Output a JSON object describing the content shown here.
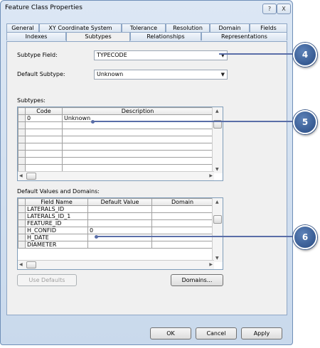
{
  "window": {
    "title": "Feature Class Properties",
    "help_glyph": "?",
    "close_glyph": "X"
  },
  "tabs_row1": [
    "General",
    "XY Coordinate System",
    "Tolerance",
    "Resolution",
    "Domain",
    "Fields"
  ],
  "tabs_row2": [
    "Indexes",
    "Subtypes",
    "Relationships",
    "Representations"
  ],
  "active_tab": "Subtypes",
  "subtype_field": {
    "label": "Subtype Field:",
    "value": "TYPECODE"
  },
  "default_subtype": {
    "label": "Default Subtype:",
    "value": "Unknown"
  },
  "subtypes": {
    "label": "Subtypes:",
    "columns": [
      "Code",
      "Description"
    ],
    "rows": [
      {
        "code": "0",
        "description": "Unknown"
      }
    ]
  },
  "defaults": {
    "label": "Default Values and Domains:",
    "columns": [
      "Field Name",
      "Default Value",
      "Domain"
    ],
    "rows": [
      {
        "field": "LATERALS_ID",
        "value": "",
        "domain": ""
      },
      {
        "field": "LATERALS_ID_1",
        "value": "",
        "domain": ""
      },
      {
        "field": "FEATURE_ID",
        "value": "",
        "domain": ""
      },
      {
        "field": "H_CONFID",
        "value": "0",
        "domain": ""
      },
      {
        "field": "H_DATE",
        "value": "",
        "domain": ""
      },
      {
        "field": "DIAMETER",
        "value": "",
        "domain": ""
      }
    ]
  },
  "buttons": {
    "use_defaults": "Use Defaults",
    "domains": "Domains...",
    "ok": "OK",
    "cancel": "Cancel",
    "apply": "Apply"
  },
  "callouts": [
    "4",
    "5",
    "6"
  ],
  "colors": {
    "callout": "#2f5590",
    "leader": "#5a6ea8"
  }
}
